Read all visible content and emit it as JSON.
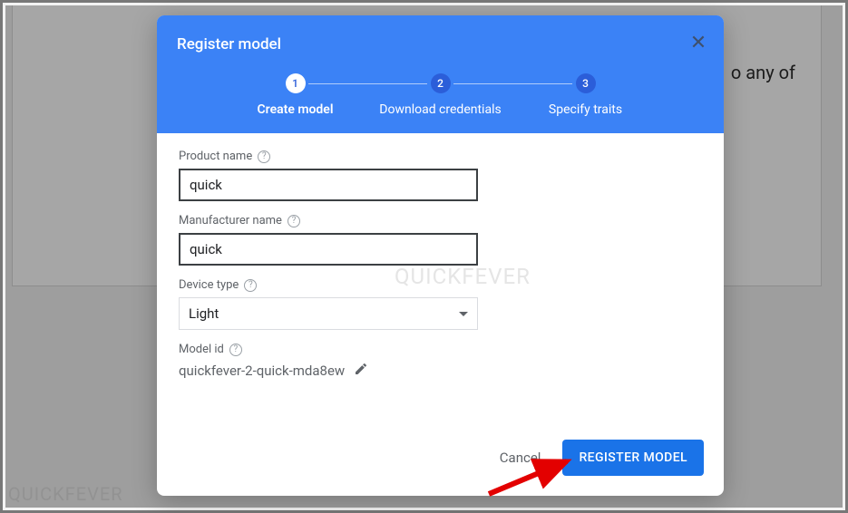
{
  "background": {
    "snippet": "o any of"
  },
  "modal": {
    "title": "Register model",
    "stepper": [
      {
        "num": "1",
        "label": "Create model",
        "active": true
      },
      {
        "num": "2",
        "label": "Download credentials",
        "active": false
      },
      {
        "num": "3",
        "label": "Specify traits",
        "active": false
      }
    ],
    "fields": {
      "product": {
        "label": "Product name",
        "value": "quick"
      },
      "manufacturer": {
        "label": "Manufacturer name",
        "value": "quick"
      },
      "deviceType": {
        "label": "Device type",
        "value": "Light"
      },
      "modelId": {
        "label": "Model id",
        "value": "quickfever-2-quick-mda8ew"
      }
    },
    "buttons": {
      "cancel": "Cancel",
      "submit": "REGISTER MODEL"
    }
  },
  "watermark": "QUICKFEVER"
}
